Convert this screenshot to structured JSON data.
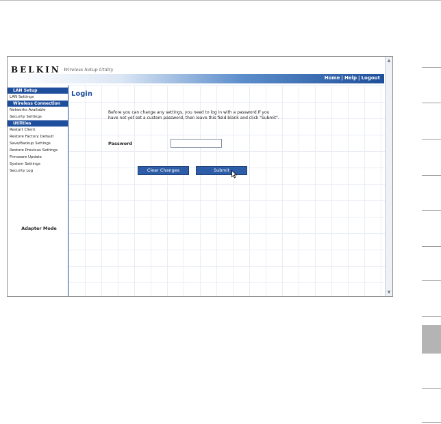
{
  "header": {
    "brand": "BELKIN",
    "brand_sub": "Wireless Setup Utility",
    "nav": {
      "home": "Home",
      "help": "Help",
      "logout": "Logout",
      "separator": "|"
    }
  },
  "sidebar": {
    "sections": [
      {
        "title": "LAN Setup",
        "items": [
          "LAN Settings"
        ]
      },
      {
        "title": "Wireless Connection",
        "items": [
          "Networks Available",
          "Security Settings"
        ]
      },
      {
        "title": "Utilities",
        "items": [
          "Restart Client",
          "Restore Factory Default",
          "Save/Backup Settings",
          "Restore Previous Settings",
          "Firmware Update",
          "System Settings",
          "Security Log"
        ]
      }
    ],
    "mode_label": "Adapter Mode"
  },
  "content": {
    "title": "Login",
    "intro": "Before you can change any settings, you need to log in with a password.If you have not yet set a custom password, then leave this field blank and click \"Submit\".",
    "password_label": "Password",
    "password_value": "",
    "clear_button": "Clear Changes",
    "submit_button": "Submit"
  },
  "colors": {
    "accent": "#1f4f9c",
    "button": "#2d5da6",
    "grid": "#e9edf4"
  },
  "icons": [
    "scroll-up-arrow-icon",
    "scroll-down-arrow-icon",
    "mouse-pointer-icon"
  ]
}
